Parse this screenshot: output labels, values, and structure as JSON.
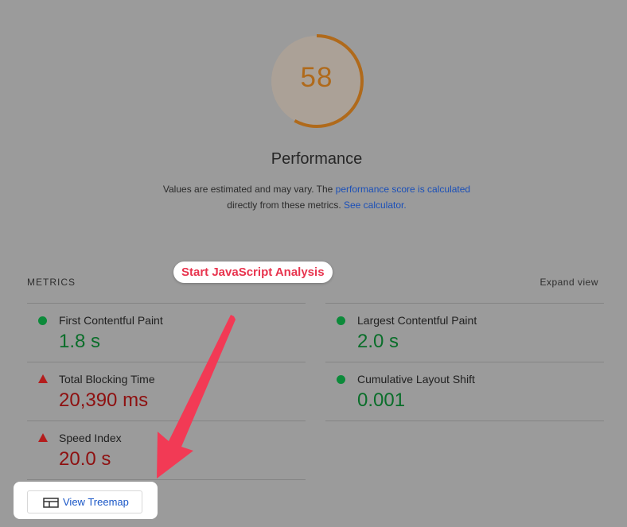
{
  "score": {
    "value": "58",
    "fraction": 0.58,
    "color": "#e67700"
  },
  "title": "Performance",
  "description": {
    "part1": "Values are estimated and may vary. The ",
    "link1": "performance score is calculated",
    "part2": "directly from these metrics. ",
    "link2": "See calculator."
  },
  "metrics": {
    "heading": "METRICS",
    "expand_label": "Expand view",
    "left": [
      {
        "label": "First Contentful Paint",
        "value": "1.8 s",
        "status": "pass"
      },
      {
        "label": "Total Blocking Time",
        "value": "20,390 ms",
        "status": "fail"
      },
      {
        "label": "Speed Index",
        "value": "20.0 s",
        "status": "fail"
      }
    ],
    "right": [
      {
        "label": "Largest Contentful Paint",
        "value": "2.0 s",
        "status": "pass"
      },
      {
        "label": "Cumulative Layout Shift",
        "value": "0.001",
        "status": "pass"
      }
    ]
  },
  "callout": {
    "label": "Start JavaScript Analysis"
  },
  "treemap": {
    "label": "View Treemap",
    "icon": "treemap-icon"
  },
  "colors": {
    "pass": "#0c8a3a",
    "fail": "#b41d1d",
    "accent": "#e8344e",
    "link": "#1a57c7"
  }
}
